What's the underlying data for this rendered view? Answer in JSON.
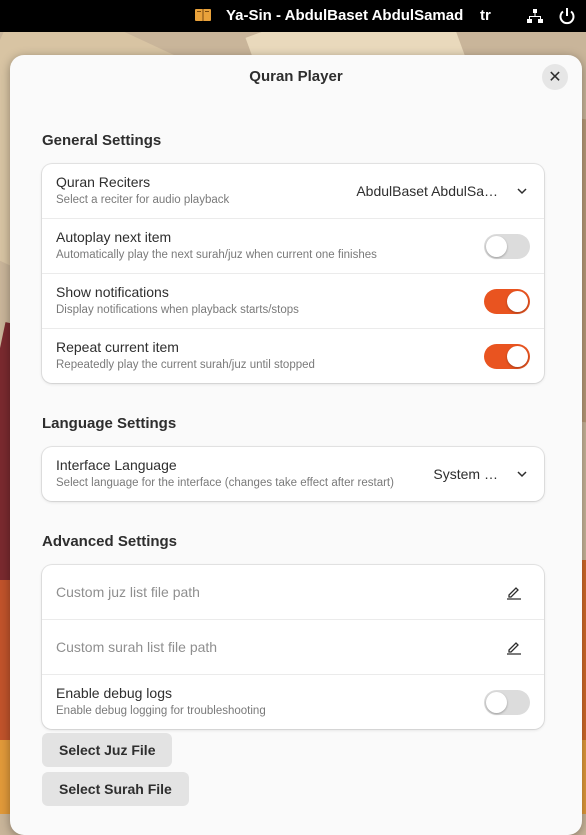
{
  "topbar": {
    "now_playing": "Ya-Sin - AbdulBaset AbdulSamad",
    "keyboard_layout": "tr",
    "app_icon": "quran-book-icon",
    "network_icon": "network-wired-icon",
    "power_icon": "power-icon"
  },
  "dialog": {
    "title": "Quran Player",
    "close_icon": "close-icon"
  },
  "general": {
    "heading": "General Settings",
    "reciters": {
      "label": "Quran Reciters",
      "subtitle": "Select a reciter for audio playback",
      "value": "AbdulBaset AbdulSa…"
    },
    "autoplay": {
      "label": "Autoplay next item",
      "subtitle": "Automatically play the next surah/juz when current one finishes",
      "enabled": false
    },
    "notifications": {
      "label": "Show notifications",
      "subtitle": "Display notifications when playback starts/stops",
      "enabled": true
    },
    "repeat": {
      "label": "Repeat current item",
      "subtitle": "Repeatedly play the current surah/juz until stopped",
      "enabled": true
    }
  },
  "language": {
    "heading": "Language Settings",
    "interface": {
      "label": "Interface Language",
      "subtitle": "Select language for the interface (changes take effect after restart)",
      "value": "System …"
    }
  },
  "advanced": {
    "heading": "Advanced Settings",
    "juz_path": {
      "placeholder": "Custom juz list file path"
    },
    "surah_path": {
      "placeholder": "Custom surah list file path"
    },
    "debug": {
      "label": "Enable debug logs",
      "subtitle": "Enable debug logging for troubleshooting",
      "enabled": false
    },
    "select_juz_button": "Select Juz File",
    "select_surah_button": "Select Surah File"
  },
  "colors": {
    "accent": "#e95420",
    "switch_off": "#dcdcdc"
  }
}
